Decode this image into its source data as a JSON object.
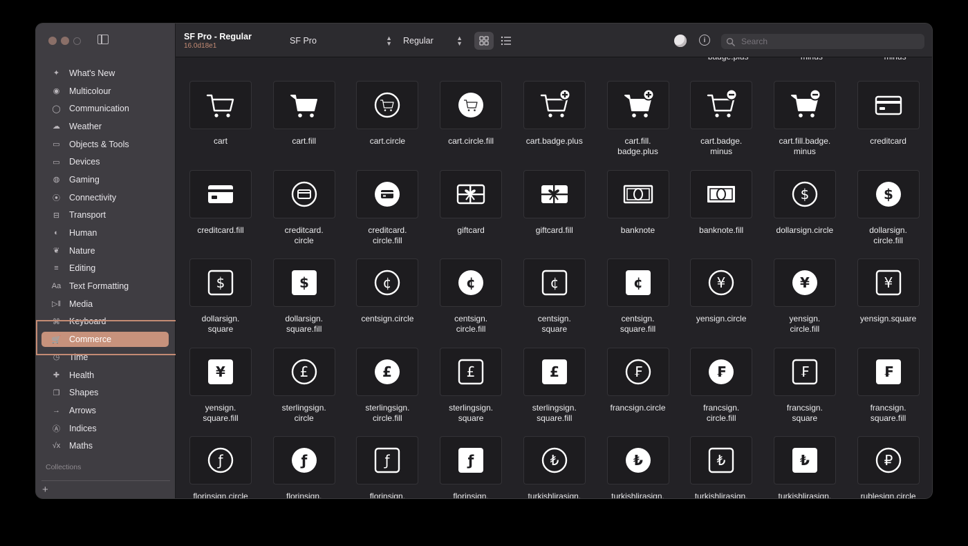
{
  "window": {
    "title": "SF Pro - Regular",
    "subtitle": "16.0d18e1"
  },
  "toolbar": {
    "font_family": "SF Pro",
    "font_weight": "Regular",
    "search_placeholder": "Search"
  },
  "sidebar": {
    "items": [
      {
        "label": "What's New",
        "icon": "sparkles-icon",
        "glyph": "✦"
      },
      {
        "label": "Multicolour",
        "icon": "paintpalette-icon",
        "glyph": "◉"
      },
      {
        "label": "Communication",
        "icon": "message-icon",
        "glyph": "◯"
      },
      {
        "label": "Weather",
        "icon": "cloud-sun-icon",
        "glyph": "☁"
      },
      {
        "label": "Objects & Tools",
        "icon": "folder-icon",
        "glyph": "▭"
      },
      {
        "label": "Devices",
        "icon": "display-icon",
        "glyph": "▭"
      },
      {
        "label": "Gaming",
        "icon": "gamecontroller-icon",
        "glyph": "◍"
      },
      {
        "label": "Connectivity",
        "icon": "antenna-icon",
        "glyph": "⦿"
      },
      {
        "label": "Transport",
        "icon": "car-icon",
        "glyph": "⊟"
      },
      {
        "label": "Human",
        "icon": "person-icon",
        "glyph": "◐"
      },
      {
        "label": "Nature",
        "icon": "leaf-icon",
        "glyph": "❦"
      },
      {
        "label": "Editing",
        "icon": "slider-icon",
        "glyph": "≡"
      },
      {
        "label": "Text Formatting",
        "icon": "textformat-icon",
        "glyph": "Aa"
      },
      {
        "label": "Media",
        "icon": "playpause-icon",
        "glyph": "▷‖"
      },
      {
        "label": "Keyboard",
        "icon": "keyboard-icon",
        "glyph": "⌘"
      },
      {
        "label": "Commerce",
        "icon": "cart-icon",
        "glyph": "🛒"
      },
      {
        "label": "Time",
        "icon": "clock-icon",
        "glyph": "◷"
      },
      {
        "label": "Health",
        "icon": "heart-icon",
        "glyph": "✚"
      },
      {
        "label": "Shapes",
        "icon": "square-on-square-icon",
        "glyph": "❐"
      },
      {
        "label": "Arrows",
        "icon": "arrow-right-icon",
        "glyph": "→"
      },
      {
        "label": "Indices",
        "icon": "a-circle-icon",
        "glyph": "Ⓐ"
      },
      {
        "label": "Maths",
        "icon": "function-icon",
        "glyph": "√x"
      }
    ],
    "selected": "Commerce",
    "collections_label": "Collections",
    "add_label": "+"
  },
  "partial_labels": [
    "badge.plus",
    "minus",
    "minus"
  ],
  "symbols": [
    {
      "label": "cart",
      "icon": "cart"
    },
    {
      "label": "cart.fill",
      "icon": "cart.fill"
    },
    {
      "label": "cart.circle",
      "icon": "cart.circle"
    },
    {
      "label": "cart.circle.fill",
      "icon": "cart.circle.fill"
    },
    {
      "label": "cart.badge.plus",
      "icon": "cart.badge.plus"
    },
    {
      "label": "cart.fill.\nbadge.plus",
      "icon": "cart.fill.badge.plus"
    },
    {
      "label": "cart.badge.\nminus",
      "icon": "cart.badge.minus"
    },
    {
      "label": "cart.fill.badge.\nminus",
      "icon": "cart.fill.badge.minus"
    },
    {
      "label": "creditcard",
      "icon": "creditcard"
    },
    {
      "label": "creditcard.fill",
      "icon": "creditcard.fill"
    },
    {
      "label": "creditcard.\ncircle",
      "icon": "creditcard.circle"
    },
    {
      "label": "creditcard.\ncircle.fill",
      "icon": "creditcard.circle.fill"
    },
    {
      "label": "giftcard",
      "icon": "giftcard"
    },
    {
      "label": "giftcard.fill",
      "icon": "giftcard.fill"
    },
    {
      "label": "banknote",
      "icon": "banknote"
    },
    {
      "label": "banknote.fill",
      "icon": "banknote.fill"
    },
    {
      "label": "dollarsign.circle",
      "icon": "circle",
      "glyph": "$"
    },
    {
      "label": "dollarsign.\ncircle.fill",
      "icon": "circle.fill",
      "glyph": "$"
    },
    {
      "label": "dollarsign.\nsquare",
      "icon": "square",
      "glyph": "$"
    },
    {
      "label": "dollarsign.\nsquare.fill",
      "icon": "square.fill",
      "glyph": "$"
    },
    {
      "label": "centsign.circle",
      "icon": "circle",
      "glyph": "¢"
    },
    {
      "label": "centsign.\ncircle.fill",
      "icon": "circle.fill",
      "glyph": "¢"
    },
    {
      "label": "centsign.\nsquare",
      "icon": "square",
      "glyph": "¢"
    },
    {
      "label": "centsign.\nsquare.fill",
      "icon": "square.fill",
      "glyph": "¢"
    },
    {
      "label": "yensign.circle",
      "icon": "circle",
      "glyph": "¥"
    },
    {
      "label": "yensign.\ncircle.fill",
      "icon": "circle.fill",
      "glyph": "¥"
    },
    {
      "label": "yensign.square",
      "icon": "square",
      "glyph": "¥"
    },
    {
      "label": "yensign.\nsquare.fill",
      "icon": "square.fill",
      "glyph": "¥"
    },
    {
      "label": "sterlingsign.\ncircle",
      "icon": "circle",
      "glyph": "£"
    },
    {
      "label": "sterlingsign.\ncircle.fill",
      "icon": "circle.fill",
      "glyph": "£"
    },
    {
      "label": "sterlingsign.\nsquare",
      "icon": "square",
      "glyph": "£"
    },
    {
      "label": "sterlingsign.\nsquare.fill",
      "icon": "square.fill",
      "glyph": "£"
    },
    {
      "label": "francsign.circle",
      "icon": "circle",
      "glyph": "₣"
    },
    {
      "label": "francsign.\ncircle.fill",
      "icon": "circle.fill",
      "glyph": "₣"
    },
    {
      "label": "francsign.\nsquare",
      "icon": "square",
      "glyph": "₣"
    },
    {
      "label": "francsign.\nsquare.fill",
      "icon": "square.fill",
      "glyph": "₣"
    },
    {
      "label": "florinsign.circle",
      "icon": "circle",
      "glyph": "ƒ"
    },
    {
      "label": "florinsign.",
      "icon": "circle.fill",
      "glyph": "ƒ"
    },
    {
      "label": "florinsign.",
      "icon": "square",
      "glyph": "ƒ"
    },
    {
      "label": "florinsign.",
      "icon": "square.fill",
      "glyph": "ƒ"
    },
    {
      "label": "turkishlirasign.",
      "icon": "circle",
      "glyph": "₺"
    },
    {
      "label": "turkishlirasign.",
      "icon": "circle.fill",
      "glyph": "₺"
    },
    {
      "label": "turkishlirasign.",
      "icon": "square",
      "glyph": "₺"
    },
    {
      "label": "turkishlirasign.",
      "icon": "square.fill",
      "glyph": "₺"
    },
    {
      "label": "rublesign.circle",
      "icon": "circle",
      "glyph": "₽"
    }
  ],
  "colors": {
    "accent": "#c7927c",
    "window_bg": "#232226",
    "sidebar_bg": "#3f3d42",
    "icon": "#ffffff"
  }
}
